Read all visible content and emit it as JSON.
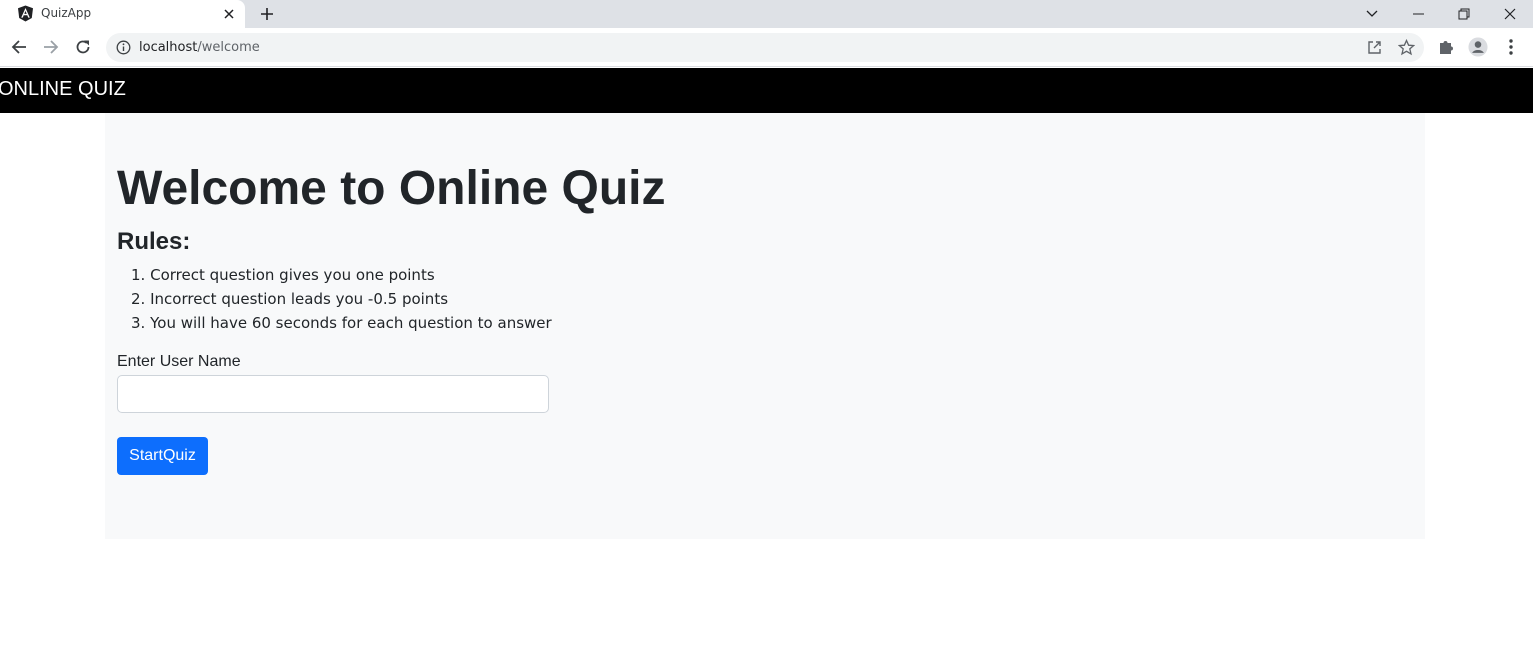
{
  "browser": {
    "tab": {
      "title": "QuizApp",
      "favicon": "angular-logo-icon",
      "close_icon": "close-icon"
    },
    "new_tab_icon": "plus-icon",
    "window_controls": [
      "chevron-down-icon",
      "minimize-icon",
      "restore-icon",
      "close-icon"
    ],
    "url_host": "localhost",
    "url_path": "/welcome",
    "toolbar_icons": [
      "share-icon",
      "star-icon",
      "puzzle-icon",
      "profile-icon",
      "kebab-menu-icon"
    ]
  },
  "navbar": {
    "brand": "ONLINE QUIZ"
  },
  "main": {
    "title": "Welcome to Online Quiz",
    "rules_heading": "Rules:",
    "rules": [
      {
        "num": "1.",
        "text": "Correct question gives you one points"
      },
      {
        "num": "2.",
        "text": "Incorrect question leads you -0.5 points"
      },
      {
        "num": "3.",
        "text": "You will have 60 seconds for each question to answer"
      }
    ],
    "username_label": "Enter User Name",
    "username_value": "",
    "start_button": "StartQuiz"
  },
  "colors": {
    "navbar_bg": "#000000",
    "container_bg": "#f8f9fa",
    "primary_button": "#0d6efd",
    "text": "#212529",
    "tabstrip_bg": "#dee1e6"
  }
}
